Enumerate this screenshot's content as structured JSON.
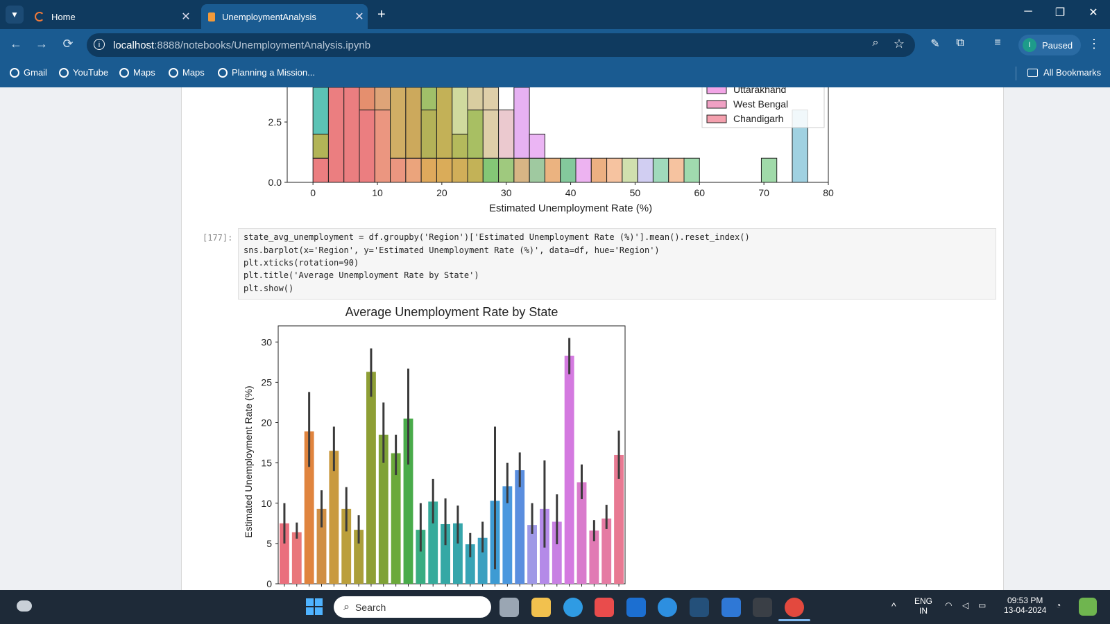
{
  "browser": {
    "tabs": [
      {
        "label": "Home",
        "active": false
      },
      {
        "label": "UnemploymentAnalysis",
        "active": true
      }
    ],
    "url_host": "localhost",
    "url_rest": ":8888/notebooks/UnemploymentAnalysis.ipynb",
    "profile_initial": "I",
    "profile_status": "Paused",
    "bookmarks": [
      "Gmail",
      "YouTube",
      "Maps",
      "Maps",
      "Planning a Mission..."
    ],
    "all_bookmarks": "All Bookmarks"
  },
  "notebook": {
    "prompt": "[177]:",
    "code_lines": [
      "state_avg_unemployment = df.groupby('Region')['Estimated Unemployment Rate (%)'].mean().reset_index()",
      "sns.barplot(x='Region', y='Estimated Unemployment Rate (%)', data=df, hue='Region')",
      "plt.xticks(rotation=90)",
      "plt.title('Average Unemployment Rate by State')",
      "plt.show()"
    ]
  },
  "chart_data": [
    {
      "type": "bar",
      "xlabel": "Estimated Unemployment Rate (%)",
      "x_ticks": [
        "0",
        "10",
        "20",
        "30",
        "40",
        "50",
        "60",
        "70",
        "80"
      ],
      "y_ticks": [
        "0.0",
        "2.5"
      ],
      "xlim": [
        -4,
        80
      ],
      "legend_placement": "top-right",
      "legend": [
        "Uttarakhand",
        "West Bengal",
        "Chandigarh"
      ],
      "legend_colors": [
        "#f2a5e6",
        "#f0a1c4",
        "#f4a0ae"
      ],
      "bins": [
        {
          "x": 0,
          "w": 2.4,
          "segs": [
            [
              0,
              1,
              "#e8676a"
            ],
            [
              1,
              2,
              "#a5a73a"
            ],
            [
              2,
              4,
              "#3fb8a8"
            ]
          ]
        },
        {
          "x": 2.4,
          "w": 2.4,
          "segs": [
            [
              0,
              4,
              "#e8676a"
            ]
          ]
        },
        {
          "x": 4.8,
          "w": 2.4,
          "segs": [
            [
              0,
              4,
              "#e8676a"
            ]
          ]
        },
        {
          "x": 7.2,
          "w": 2.4,
          "segs": [
            [
              0,
              3,
              "#e8676a"
            ],
            [
              3,
              4,
              "#e07b55"
            ]
          ]
        },
        {
          "x": 9.6,
          "w": 2.4,
          "segs": [
            [
              0,
              3,
              "#e8846a"
            ],
            [
              3,
              4,
              "#d89460"
            ]
          ]
        },
        {
          "x": 12,
          "w": 2.4,
          "segs": [
            [
              0,
              1,
              "#e8846a"
            ],
            [
              1,
              4,
              "#c9a04a"
            ]
          ]
        },
        {
          "x": 14.4,
          "w": 2.4,
          "segs": [
            [
              0,
              1,
              "#e89465"
            ],
            [
              1,
              4,
              "#c39a3f"
            ]
          ]
        },
        {
          "x": 16.8,
          "w": 2.4,
          "segs": [
            [
              0,
              1,
              "#d99a3f"
            ],
            [
              1,
              3,
              "#a7a43b"
            ],
            [
              3,
              4,
              "#8fb54f"
            ]
          ]
        },
        {
          "x": 19.2,
          "w": 2.4,
          "segs": [
            [
              0,
              1,
              "#d39d3c"
            ],
            [
              1,
              4,
              "#b9a33a"
            ]
          ]
        },
        {
          "x": 21.6,
          "w": 2.4,
          "segs": [
            [
              0,
              1,
              "#c9a03c"
            ],
            [
              1,
              2,
              "#a7ae40"
            ],
            [
              2,
              4,
              "#c8d48d"
            ]
          ]
        },
        {
          "x": 24,
          "w": 2.4,
          "segs": [
            [
              0,
              1,
              "#b8a43a"
            ],
            [
              1,
              3,
              "#99b448"
            ],
            [
              3,
              4,
              "#d2c48f"
            ]
          ]
        },
        {
          "x": 26.4,
          "w": 2.4,
          "segs": [
            [
              0,
              1,
              "#6fbd5e"
            ],
            [
              1,
              3,
              "#d9c79a"
            ],
            [
              3,
              4,
              "#d9c79a"
            ]
          ]
        },
        {
          "x": 28.8,
          "w": 2.4,
          "segs": [
            [
              0,
              1,
              "#8ebf67"
            ],
            [
              1,
              3,
              "#e8bfc7"
            ]
          ]
        },
        {
          "x": 31.2,
          "w": 2.4,
          "segs": [
            [
              0,
              1,
              "#d0a870"
            ],
            [
              1,
              4,
              "#e2a3f0"
            ]
          ]
        },
        {
          "x": 33.6,
          "w": 2.4,
          "segs": [
            [
              0,
              1,
              "#8ebf8f"
            ],
            [
              1,
              2,
              "#e7a8f2"
            ]
          ]
        },
        {
          "x": 36,
          "w": 2.4,
          "segs": [
            [
              0,
              1,
              "#e7a66a"
            ]
          ]
        },
        {
          "x": 38.4,
          "w": 2.4,
          "segs": [
            [
              0,
              1,
              "#6fc08b"
            ]
          ]
        },
        {
          "x": 40.8,
          "w": 2.4,
          "segs": [
            [
              0,
              1,
              "#eaa6ef"
            ]
          ]
        },
        {
          "x": 43.2,
          "w": 2.4,
          "segs": [
            [
              0,
              1,
              "#e9a26c"
            ]
          ]
        },
        {
          "x": 45.6,
          "w": 2.4,
          "segs": [
            [
              0,
              1,
              "#f4b98f"
            ]
          ]
        },
        {
          "x": 48,
          "w": 2.4,
          "segs": [
            [
              0,
              1,
              "#c8dba0"
            ]
          ]
        },
        {
          "x": 50.4,
          "w": 2.4,
          "segs": [
            [
              0,
              1,
              "#c9c5f0"
            ]
          ]
        },
        {
          "x": 52.8,
          "w": 2.4,
          "segs": [
            [
              0,
              1,
              "#8fd4b0"
            ]
          ]
        },
        {
          "x": 55.2,
          "w": 2.4,
          "segs": [
            [
              0,
              1,
              "#f4b98f"
            ]
          ]
        },
        {
          "x": 57.6,
          "w": 2.4,
          "segs": [
            [
              0,
              1,
              "#8fd4a0"
            ]
          ]
        },
        {
          "x": 69.6,
          "w": 2.4,
          "segs": [
            [
              0,
              1,
              "#8fd49a"
            ]
          ]
        },
        {
          "x": 74.4,
          "w": 2.4,
          "segs": [
            [
              0,
              3,
              "#8fc9dc"
            ]
          ]
        }
      ]
    },
    {
      "type": "bar",
      "title": "Average Unemployment Rate by State",
      "ylabel": "Estimated Unemployment Rate (%)",
      "ylim": [
        0,
        32
      ],
      "y_ticks": [
        0,
        5,
        10,
        15,
        20,
        25,
        30
      ],
      "values": [
        7.5,
        6.4,
        18.9,
        9.3,
        16.5,
        9.3,
        6.7,
        26.3,
        18.5,
        16.2,
        20.5,
        6.7,
        10.2,
        7.4,
        7.5,
        4.9,
        5.7,
        10.3,
        12.1,
        14.1,
        7.3,
        9.3,
        7.7,
        28.3,
        12.6,
        6.6,
        8.1,
        16.0
      ],
      "errors": [
        [
          5.0,
          10.0
        ],
        [
          5.6,
          7.6
        ],
        [
          14.5,
          23.8
        ],
        [
          7.0,
          11.6
        ],
        [
          14.0,
          19.5
        ],
        [
          6.5,
          12.0
        ],
        [
          5.0,
          8.5
        ],
        [
          23.2,
          29.2
        ],
        [
          15.0,
          22.5
        ],
        [
          13.5,
          18.5
        ],
        [
          14.8,
          26.7
        ],
        [
          4.0,
          10.0
        ],
        [
          7.5,
          13.0
        ],
        [
          4.8,
          10.6
        ],
        [
          5.0,
          9.7
        ],
        [
          3.3,
          6.3
        ],
        [
          3.9,
          7.7
        ],
        [
          1.8,
          19.5
        ],
        [
          10.0,
          15.0
        ],
        [
          12.0,
          16.3
        ],
        [
          6.2,
          10.0
        ],
        [
          4.5,
          15.3
        ],
        [
          4.9,
          11.1
        ],
        [
          26.0,
          30.5
        ],
        [
          10.5,
          14.8
        ],
        [
          5.3,
          7.9
        ],
        [
          6.8,
          9.8
        ],
        [
          13.0,
          19.0
        ]
      ],
      "colors": [
        "#ea6f7d",
        "#e9777b",
        "#e0843e",
        "#d08f44",
        "#c99a3f",
        "#bb9f3c",
        "#ab9f3a",
        "#8e9f35",
        "#7fa237",
        "#6ba93b",
        "#49ab4a",
        "#39ad82",
        "#36ab9b",
        "#35a8a5",
        "#36a6ab",
        "#37a4b6",
        "#3aa0c0",
        "#3e9bd3",
        "#4a97de",
        "#5a8edf",
        "#9f98e6",
        "#b48ae8",
        "#c880e3",
        "#d47ae0",
        "#d97bcc",
        "#e17ab4",
        "#e57ba3",
        "#e87992"
      ]
    }
  ],
  "taskbar": {
    "search_placeholder": "Search",
    "lang_1": "ENG",
    "lang_2": "IN",
    "time": "09:53 PM",
    "date": "13-04-2024"
  }
}
